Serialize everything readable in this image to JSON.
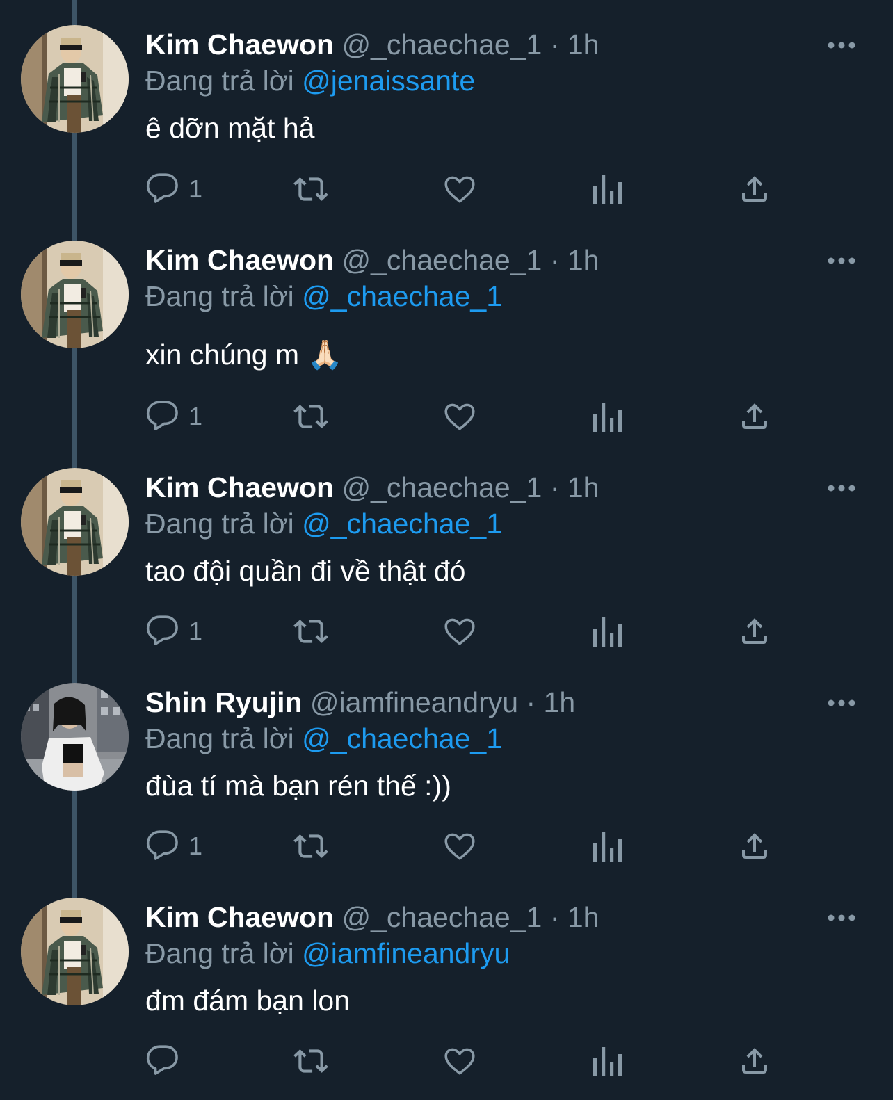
{
  "reply_prefix": "Đang trả lời",
  "tweets": [
    {
      "name": "Kim Chaewon",
      "handle": "@_chaechae_1",
      "separator": "·",
      "time": "1h",
      "reply_to": "@jenaissante",
      "text": "ê dỡn mặt hả",
      "reply_count": "1",
      "avatar": "avatar-photo-kim-chaewon"
    },
    {
      "name": "Kim Chaewon",
      "handle": "@_chaechae_1",
      "separator": "·",
      "time": "1h",
      "reply_to": "@_chaechae_1",
      "text": "xin chúng m 🙏🏻",
      "reply_count": "1",
      "avatar": "avatar-photo-kim-chaewon"
    },
    {
      "name": "Kim Chaewon",
      "handle": "@_chaechae_1",
      "separator": "·",
      "time": "1h",
      "reply_to": "@_chaechae_1",
      "text": "tao đội quần đi về thật đó",
      "reply_count": "1",
      "avatar": "avatar-photo-kim-chaewon"
    },
    {
      "name": "Shin Ryujin",
      "handle": "@iamfineandryu",
      "separator": "·",
      "time": "1h",
      "reply_to": "@_chaechae_1",
      "text": "đùa tí mà bạn rén thế :))",
      "reply_count": "1",
      "avatar": "avatar-photo-shin-ryujin"
    },
    {
      "name": "Kim Chaewon",
      "handle": "@_chaechae_1",
      "separator": "·",
      "time": "1h",
      "reply_to": "@iamfineandryu",
      "text": "đm đám bạn lon",
      "reply_count": "",
      "avatar": "avatar-photo-kim-chaewon"
    }
  ],
  "icons": {
    "reply": "reply-icon",
    "retweet": "retweet-icon",
    "like": "heart-icon",
    "analytics": "analytics-icon",
    "share": "share-icon",
    "more": "more-icon"
  },
  "colors": {
    "background": "#15202b",
    "secondary_text": "#8899a6",
    "mention": "#1d9bf0",
    "thread_line": "#3d5466"
  }
}
